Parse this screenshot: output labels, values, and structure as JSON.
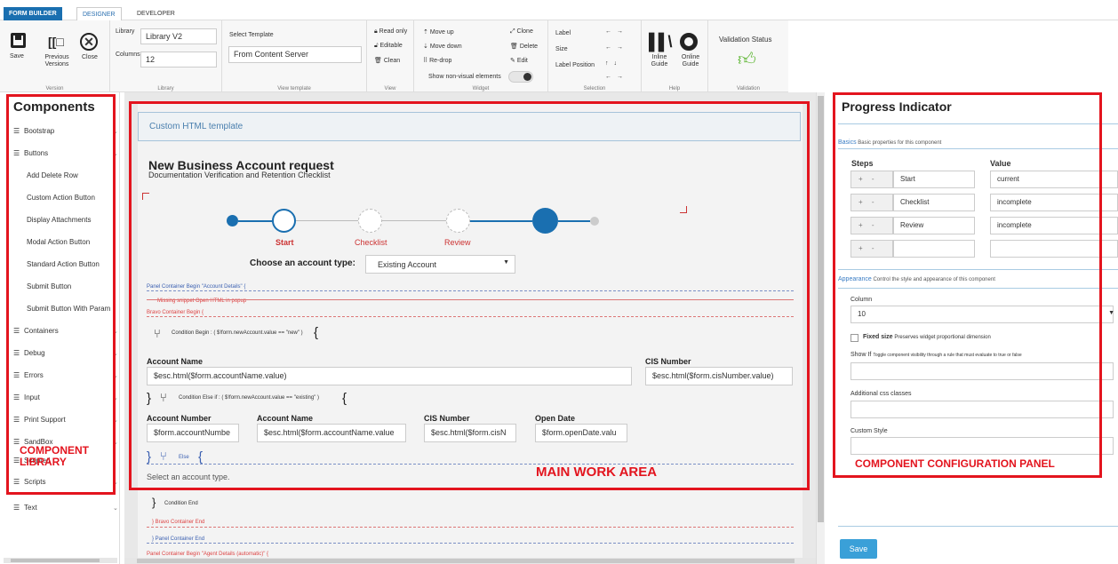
{
  "tabs": {
    "form_builder": "FORM BUILDER",
    "designer": "DESIGNER",
    "developer": "DEVELOPER"
  },
  "ribbon": {
    "version": {
      "save": "Save",
      "previous": "Previous Versions",
      "close": "Close",
      "group": "Version"
    },
    "library": {
      "library_label": "Library",
      "library_value": "Library V2",
      "columns_label": "Columns",
      "columns_value": "12",
      "group": "Library"
    },
    "view_template": {
      "select_label": "Select Template",
      "from_content": "From Content Server",
      "group": "View template"
    },
    "view": {
      "read_only": "Read only",
      "editable": "Editable",
      "clean": "Clean",
      "group": "View"
    },
    "widget": {
      "move_up": "Move up",
      "move_down": "Move down",
      "re_drop": "Re-drop",
      "clone": "Clone",
      "delete": "Delete",
      "edit": "Edit",
      "show_non_visual": "Show non-visual elements",
      "group": "Widget"
    },
    "selection": {
      "label": "Label",
      "size": "Size",
      "label_position": "Label Position",
      "group": "Selection"
    },
    "help": {
      "inline": "Inline Guide",
      "online": "Online Guide",
      "group": "Help"
    },
    "validation": {
      "status": "Validation Status",
      "group": "Validation"
    }
  },
  "components": {
    "title": "Components",
    "items": [
      "Bootstrap",
      "Buttons",
      "Add Delete Row",
      "Custom Action Button",
      "Display Attachments",
      "Modal Action Button",
      "Standard Action Button",
      "Submit Button",
      "Submit Button With Param",
      "Containers",
      "Debug",
      "Errors",
      "Input",
      "Print Support",
      "SandBox",
      "Scripted",
      "Scripts",
      "Text"
    ]
  },
  "annotations": {
    "component_library": "COMPONENT LIBRARY",
    "main_work_area": "MAIN WORK AREA",
    "config_panel": "COMPONENT CONFIGURATION PANEL"
  },
  "canvas": {
    "custom_html": "Custom HTML template",
    "title": "New Business Account request",
    "subtitle": "Documentation Verification and Retention Checklist",
    "steps": [
      "Start",
      "Checklist",
      "Review"
    ],
    "account_type_label": "Choose an account type:",
    "account_type_value": "Existing Account",
    "panel_begin": "Panel Container Begin \"Account Details\"   {",
    "missing_snippet": "Missing snippet Open HTML in popup",
    "bravo_begin": "Bravo Container Begin   {",
    "cond_begin": "Condition Begin : ( $!form.newAccount.value == \"new\" )",
    "account_name_label": "Account Name",
    "account_name_value": "$esc.html($form.accountName.value)",
    "cis_label": "CIS Number",
    "cis_value": "$esc.html($form.cisNumber.value)",
    "cond_else_if": "Condition Else if : ( $!form.newAccount.value == \"existing\" )",
    "acct_number_label": "Account Number",
    "acct_number_value": "$form.accountNumbe",
    "acct_name2_label": "Account Name",
    "acct_name2_value": "$esc.html($form.accountName.value",
    "cis2_label": "CIS Number",
    "cis2_value": "$esc.html($form.cisN",
    "open_date_label": "Open Date",
    "open_date_value": "$form.openDate.valu",
    "else": "Else",
    "select_type": "Select an account type.",
    "cond_end": "Condition End",
    "bravo_end": "}   Bravo Container End",
    "panel_end": "}   Panel Container End",
    "panel_agent": "Panel Container Begin \"Agent Details (automatic)\"   {"
  },
  "config": {
    "title": "Progress Indicator",
    "basics": "Basics",
    "basics_desc": "Basic properties for this component",
    "steps_hdr": "Steps",
    "value_hdr": "Value",
    "rows": [
      {
        "step": "Start",
        "value": "current"
      },
      {
        "step": "Checklist",
        "value": "incomplete"
      },
      {
        "step": "Review",
        "value": "incomplete"
      },
      {
        "step": "",
        "value": ""
      }
    ],
    "pm": "+ -",
    "appearance": "Appearance",
    "appearance_desc": "Control the style and appearance of this component",
    "column_label": "Column",
    "column_value": "10",
    "fixed_size": "Fixed size",
    "fixed_size_desc": "Preserves widget proportional dimension",
    "show_if": "Show If",
    "show_if_desc": "Toggle component visibility through a rule that must evaluate to true or false",
    "css_label": "Additional css classes",
    "style_label": "Custom Style",
    "save": "Save"
  },
  "colors": {
    "accent": "#1a6fb0",
    "red": "#e3141e",
    "green": "#5cb531"
  }
}
